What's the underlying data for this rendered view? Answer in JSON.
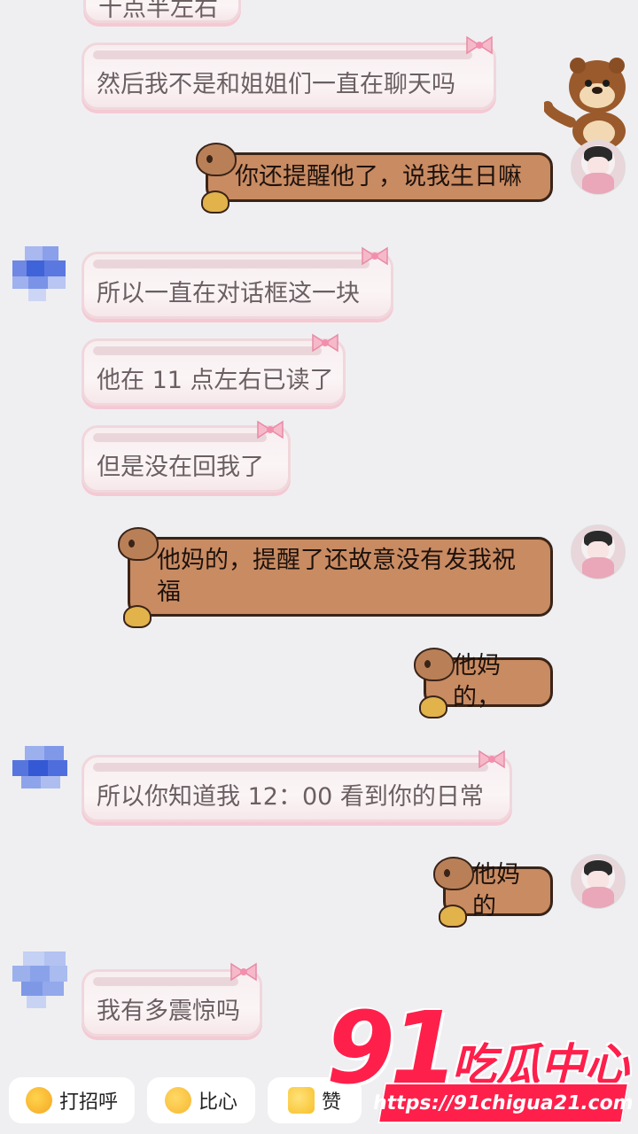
{
  "messages": [
    {
      "id": "m0",
      "side": "left",
      "text": "十点半左右"
    },
    {
      "id": "m1",
      "side": "left",
      "text": "然后我不是和姐姐们一直在聊天吗"
    },
    {
      "id": "m2",
      "side": "right",
      "text": "你还提醒他了，说我生日嘛"
    },
    {
      "id": "m3",
      "side": "left",
      "text": "所以一直在对话框这一块"
    },
    {
      "id": "m4",
      "side": "left",
      "text": "他在 11 点左右已读了"
    },
    {
      "id": "m5",
      "side": "left",
      "text": "但是没在回我了"
    },
    {
      "id": "m6",
      "side": "right",
      "text": "他妈的，提醒了还故意没有发我祝福"
    },
    {
      "id": "m7",
      "side": "right",
      "text": "他妈的，"
    },
    {
      "id": "m8",
      "side": "left",
      "text": "所以你知道我 12：00 看到你的日常"
    },
    {
      "id": "m9",
      "side": "right",
      "text": "他妈的"
    },
    {
      "id": "m10",
      "side": "left",
      "text": "我有多震惊吗"
    }
  ],
  "quick_actions": [
    {
      "label": "打招呼",
      "icon": "wave-emoji-icon",
      "color": "#f5a623"
    },
    {
      "label": "比心",
      "icon": "heart-hands-emoji-icon",
      "color": "#f7b731"
    },
    {
      "label": "赞",
      "icon": "thumbs-up-icon",
      "color": "#f7c02a"
    }
  ],
  "watermark": {
    "number": "91",
    "brand": "吃瓜中心",
    "url": "https://91chigua21.com",
    "color": "#ff1f4b"
  },
  "colors": {
    "background": "#efeff2",
    "left_bubble": "#f9f1f3",
    "right_bubble": "#c98b62",
    "right_bubble_border": "#3a2418"
  }
}
